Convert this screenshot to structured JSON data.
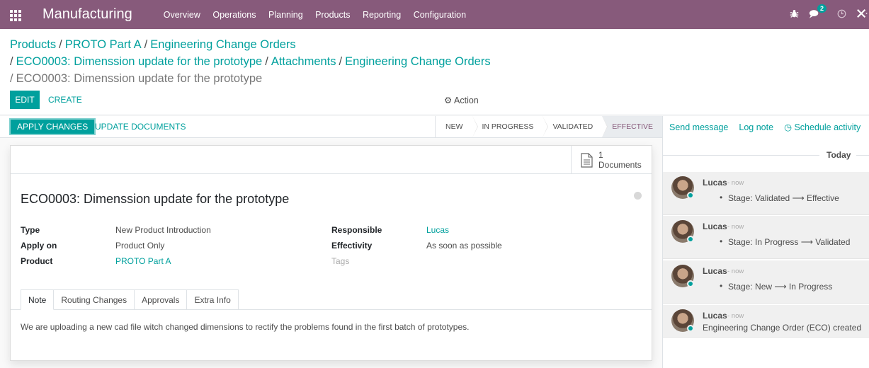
{
  "navbar": {
    "brand": "Manufacturing",
    "menu": [
      "Overview",
      "Operations",
      "Planning",
      "Products",
      "Reporting",
      "Configuration"
    ],
    "chat_badge": "2"
  },
  "breadcrumb": {
    "items": [
      "Products",
      "PROTO Part A",
      "Engineering Change Orders",
      "ECO0003: Dimenssion update for the prototype",
      "Attachments",
      "Engineering Change Orders"
    ],
    "current": "ECO0003: Dimenssion update for the prototype"
  },
  "control": {
    "edit_label": "EDIT",
    "create_label": "CREATE",
    "action_label": "Action"
  },
  "statusbar": {
    "apply_label": "APPLY CHANGES",
    "update_label": "UPDATE DOCUMENTS",
    "stages": [
      "NEW",
      "IN PROGRESS",
      "VALIDATED",
      "EFFECTIVE"
    ],
    "current_stage": "EFFECTIVE"
  },
  "sheet": {
    "documents_count": "1",
    "documents_label": "Documents",
    "title": "ECO0003: Dimenssion update for the prototype",
    "fields_left": [
      {
        "label": "Type",
        "value": "New Product Introduction"
      },
      {
        "label": "Apply on",
        "value": "Product Only"
      },
      {
        "label": "Product",
        "value": "PROTO Part A"
      }
    ],
    "fields_right": [
      {
        "label": "Responsible",
        "value": "Lucas"
      },
      {
        "label": "Effectivity",
        "value": "As soon as possible"
      },
      {
        "label": "Tags",
        "value": ""
      }
    ],
    "tabs": [
      "Note",
      "Routing Changes",
      "Approvals",
      "Extra Info"
    ],
    "active_tab": "Note",
    "note": "We are uploading a new cad file witch changed dimensions to rectify the problems found in the first batch of prototypes."
  },
  "chatter": {
    "send_message": "Send message",
    "log_note": "Log note",
    "schedule_activity": "Schedule activity",
    "today": "Today",
    "messages": [
      {
        "author": "Lucas",
        "time": "- now",
        "body": "Stage: Validated ⟶ Effective"
      },
      {
        "author": "Lucas",
        "time": "- now",
        "body": "Stage: In Progress ⟶ Validated"
      },
      {
        "author": "Lucas",
        "time": "- now",
        "body": "Stage: New ⟶ In Progress"
      },
      {
        "author": "Lucas",
        "time": "- now",
        "body": "Engineering Change Order (ECO) created"
      }
    ]
  }
}
